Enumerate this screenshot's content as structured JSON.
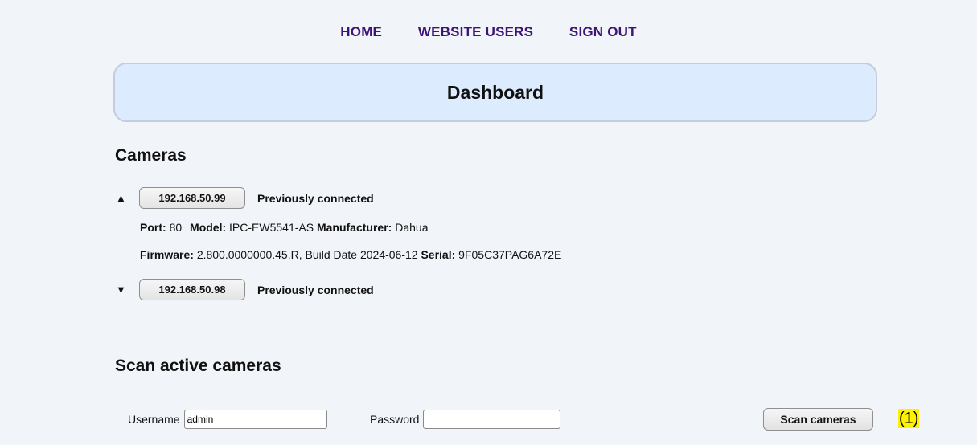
{
  "nav": {
    "home": "HOME",
    "users": "WEBSITE USERS",
    "signout": "SIGN OUT"
  },
  "dashboard": {
    "title": "Dashboard"
  },
  "cameras": {
    "title": "Cameras",
    "items": [
      {
        "toggle": "▲",
        "ip": "192.168.50.99",
        "status": "Previously connected",
        "expanded": true,
        "port_label": "Port:",
        "port": "80",
        "model_label": "Model:",
        "model": "IPC-EW5541-AS",
        "manufacturer_label": "Manufacturer:",
        "manufacturer": "Dahua",
        "firmware_label": "Firmware:",
        "firmware": "2.800.0000000.45.R, Build Date 2024-06-12",
        "serial_label": "Serial:",
        "serial": "9F05C37PAG6A72E"
      },
      {
        "toggle": "▼",
        "ip": "192.168.50.98",
        "status": "Previously connected",
        "expanded": false
      }
    ]
  },
  "scan": {
    "title": "Scan active cameras",
    "username_label": "Username",
    "username_value": "admin",
    "password_label": "Password",
    "password_value": "",
    "button": "Scan cameras"
  },
  "annotation": "(1)",
  "colors": {
    "nav_link": "#3d1577",
    "panel_bg": "#dcebfd",
    "page_bg": "#f1f4f9",
    "highlight": "#fff200"
  }
}
